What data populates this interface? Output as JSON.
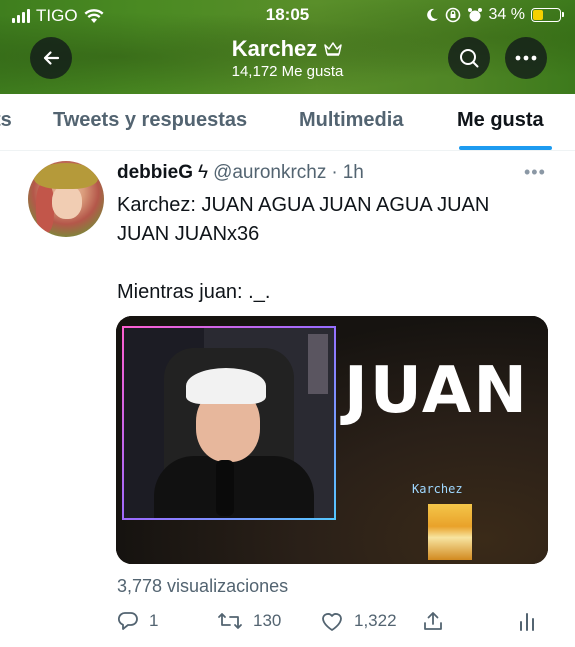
{
  "status_bar": {
    "carrier": "TIGO",
    "time": "18:05",
    "battery": "34 %",
    "battery_level": 0.34,
    "colors": {
      "battery_fill": "#f5d000"
    }
  },
  "header": {
    "profile_name": "Karchez",
    "likes_count": "14,172 Me gusta",
    "banner_color": "#4a8a22"
  },
  "tabs": [
    {
      "label": "ts"
    },
    {
      "label": "Tweets y respuestas"
    },
    {
      "label": "Multimedia"
    },
    {
      "label": "Me gusta",
      "active": true
    }
  ],
  "accent_color": "#1d9bf0",
  "tweet": {
    "author_name": "debbieG",
    "author_emoji": "ϟ",
    "handle": "@auronkrchz",
    "separator": "·",
    "time": "1h",
    "text": "Karchez: JUAN AGUA JUAN AGUA JUAN JUAN JUANx36\n\nMientras juan: ._.",
    "media": {
      "overlay_text": "JUAN",
      "game_tag": "Karchez"
    },
    "views": "3,778 visualizaciones",
    "replies": "1",
    "retweets": "130",
    "likes": "1,322"
  }
}
